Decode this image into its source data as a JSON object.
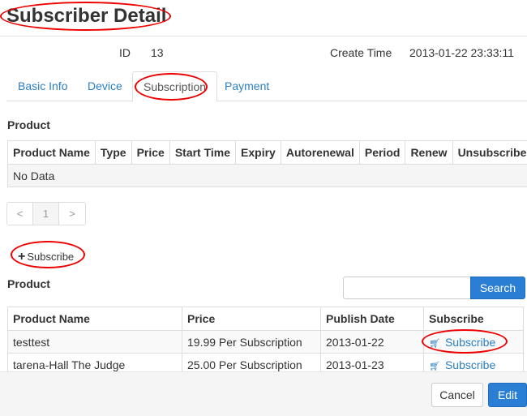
{
  "page": {
    "title": "Subscriber Detail"
  },
  "meta": {
    "id_label": "ID",
    "id_value": "13",
    "create_time_label": "Create Time",
    "create_time_value": "2013-01-22 23:33:11"
  },
  "tabs": [
    {
      "label": "Basic Info"
    },
    {
      "label": "Device"
    },
    {
      "label": "Subscription"
    },
    {
      "label": "Payment"
    }
  ],
  "current_products": {
    "label": "Product",
    "columns": [
      "Product Name",
      "Type",
      "Price",
      "Start Time",
      "Expiry",
      "Autorenewal",
      "Period",
      "Renew",
      "Unsubscribe"
    ],
    "empty_text": "No Data"
  },
  "pager": {
    "prev": "<",
    "page": "1",
    "next": ">"
  },
  "add_subscribe": {
    "label": "Subscribe"
  },
  "available_products": {
    "label": "Product",
    "search_button": "Search",
    "search_value": "",
    "columns": [
      "Product Name",
      "Price",
      "Publish Date",
      "Subscribe"
    ],
    "rows": [
      {
        "name": "testtest",
        "price": "19.99 Per Subscription",
        "date": "2013-01-22",
        "action": "Subscribe"
      },
      {
        "name": "tarena-Hall The Judge",
        "price": "25.00 Per Subscription",
        "date": "2013-01-23",
        "action": "Subscribe"
      }
    ]
  },
  "footer": {
    "cancel": "Cancel",
    "edit": "Edit"
  },
  "colors": {
    "accent": "#2a7fd4",
    "link": "#2a7fc1",
    "annotation": "#e00000"
  }
}
